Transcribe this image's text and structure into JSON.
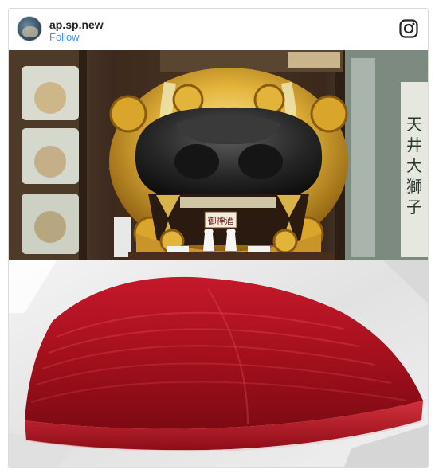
{
  "post": {
    "username": "ap.sp.new",
    "follow_label": "Follow"
  },
  "icons": {
    "brand_icon": "instagram-icon",
    "avatar": "avatar"
  },
  "photo": {
    "top_scene": "shrine-lion-mask",
    "bottom_scene": "raw-tuna-block",
    "sign_text": "御神酒"
  },
  "colors": {
    "follow": "#3897f0",
    "username": "#262626",
    "border": "#dbdbdb",
    "tuna": "#a5101d"
  }
}
